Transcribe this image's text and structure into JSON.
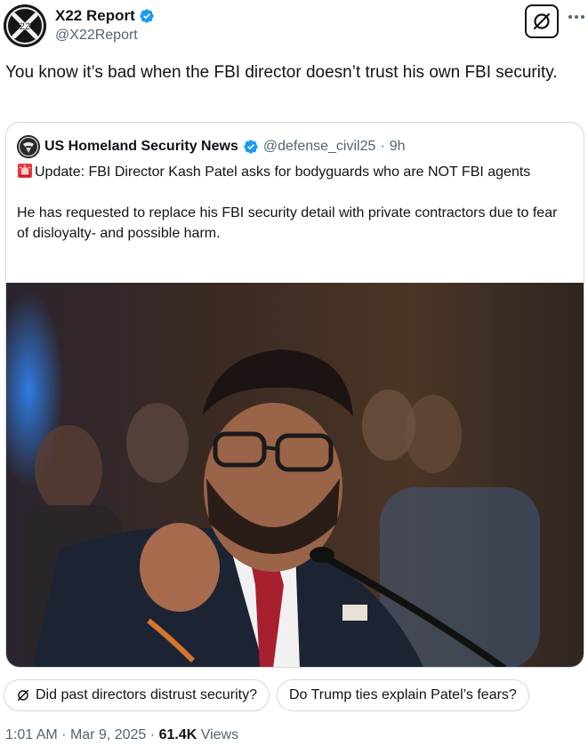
{
  "author": {
    "name": "X22 Report",
    "handle": "@X22Report",
    "avatar_icon": "x22-logo-icon",
    "verified_color": "#1d9bf0"
  },
  "tweet": {
    "text": "You know it’s bad when the FBI director doesn’t trust his own FBI security."
  },
  "quoted": {
    "name": "US Homeland Security News",
    "handle": "@defense_civil25",
    "separator": "·",
    "time": "9h",
    "paragraph1": "Update: FBI Director Kash Patel asks for bodyguards who are NOT FBI agents",
    "paragraph2": "He has requested to replace his FBI security detail with private contractors due to fear of disloyalty- and possible harm.",
    "alarm_icon": "rotating-light-icon"
  },
  "grok_suggestions": [
    "Did past directors distrust security?",
    "Do Trump ties explain Patel’s fears?"
  ],
  "meta": {
    "time": "1:01 AM",
    "dot1": "·",
    "date": "Mar 9, 2025",
    "dot2": "·",
    "views_count": "61.4K",
    "views_label": "Views"
  },
  "colors": {
    "text_primary": "#0f1419",
    "text_secondary": "#536471",
    "border": "#cfd9de",
    "verified": "#1d9bf0"
  }
}
